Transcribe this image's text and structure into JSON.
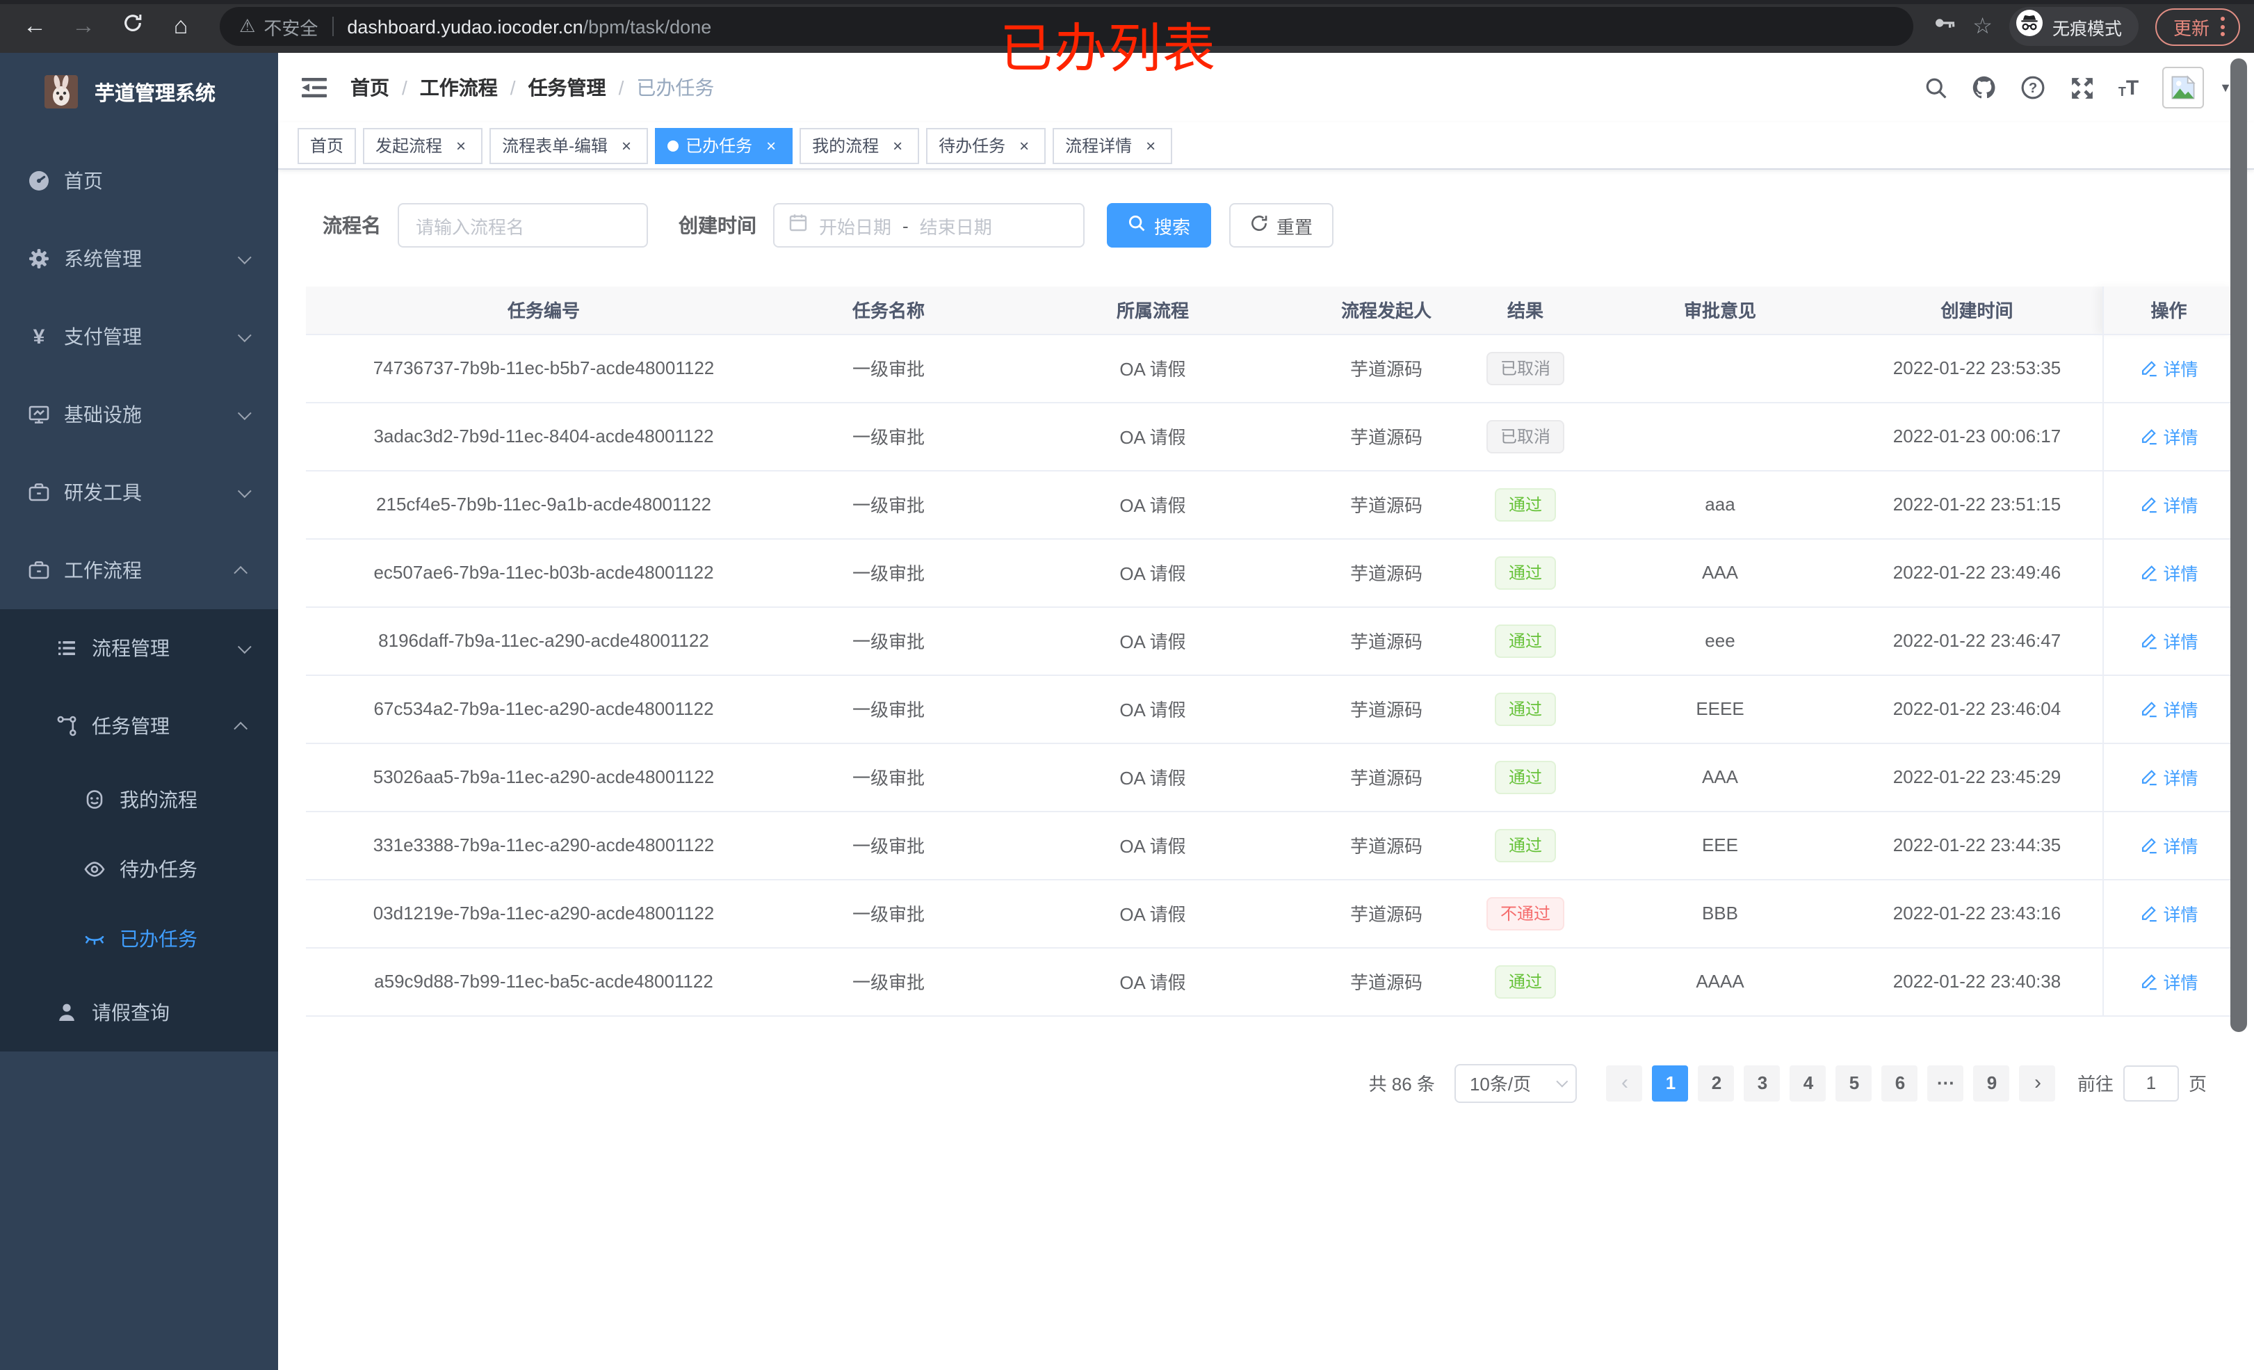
{
  "browser": {
    "security_label": "不安全",
    "url_host": "dashboard.yudao.iocoder.cn",
    "url_path": "/bpm/task/done",
    "incognito_label": "无痕模式",
    "update_label": "更新"
  },
  "icons": {
    "back": "←",
    "forward": "→",
    "home": "⌂",
    "star": "☆",
    "warning": "⚠",
    "caret": "▼",
    "close": "×",
    "prev": "‹",
    "next": "›",
    "yen": "¥",
    "question": "?",
    "tsize_small": "T",
    "tsize_big": "T"
  },
  "overlay_title": "已办列表",
  "sidebar": {
    "logo_title": "芋道管理系统",
    "items": [
      {
        "label": "首页"
      },
      {
        "label": "系统管理"
      },
      {
        "label": "支付管理"
      },
      {
        "label": "基础设施"
      },
      {
        "label": "研发工具"
      },
      {
        "label": "工作流程"
      }
    ],
    "submenu": [
      {
        "label": "流程管理"
      },
      {
        "label": "任务管理"
      },
      {
        "label": "我的流程"
      },
      {
        "label": "待办任务"
      },
      {
        "label": "已办任务"
      },
      {
        "label": "请假查询"
      }
    ]
  },
  "header": {
    "breadcrumb": [
      "首页",
      "工作流程",
      "任务管理",
      "已办任务"
    ],
    "separator": "/"
  },
  "tabs": [
    {
      "label": "首页"
    },
    {
      "label": "发起流程"
    },
    {
      "label": "流程表单-编辑"
    },
    {
      "label": "已办任务"
    },
    {
      "label": "我的流程"
    },
    {
      "label": "待办任务"
    },
    {
      "label": "流程详情"
    }
  ],
  "filters": {
    "name_label": "流程名",
    "name_placeholder": "请输入流程名",
    "time_label": "创建时间",
    "start_placeholder": "开始日期",
    "range_separator": "-",
    "end_placeholder": "结束日期",
    "search_label": "搜索",
    "reset_label": "重置"
  },
  "table": {
    "columns": [
      "任务编号",
      "任务名称",
      "所属流程",
      "流程发起人",
      "结果",
      "审批意见",
      "创建时间",
      "操作"
    ],
    "detail_label": "详情",
    "rows": [
      {
        "id": "74736737-7b9b-11ec-b5b7-acde48001122",
        "name": "一级审批",
        "process": "OA 请假",
        "initiator": "芋道源码",
        "result": "已取消",
        "comment": "",
        "time": "2022-01-22 23:53:35"
      },
      {
        "id": "3adac3d2-7b9d-11ec-8404-acde48001122",
        "name": "一级审批",
        "process": "OA 请假",
        "initiator": "芋道源码",
        "result": "已取消",
        "comment": "",
        "time": "2022-01-23 00:06:17"
      },
      {
        "id": "215cf4e5-7b9b-11ec-9a1b-acde48001122",
        "name": "一级审批",
        "process": "OA 请假",
        "initiator": "芋道源码",
        "result": "通过",
        "comment": "aaa",
        "time": "2022-01-22 23:51:15"
      },
      {
        "id": "ec507ae6-7b9a-11ec-b03b-acde48001122",
        "name": "一级审批",
        "process": "OA 请假",
        "initiator": "芋道源码",
        "result": "通过",
        "comment": "AAA",
        "time": "2022-01-22 23:49:46"
      },
      {
        "id": "8196daff-7b9a-11ec-a290-acde48001122",
        "name": "一级审批",
        "process": "OA 请假",
        "initiator": "芋道源码",
        "result": "通过",
        "comment": "eee",
        "time": "2022-01-22 23:46:47"
      },
      {
        "id": "67c534a2-7b9a-11ec-a290-acde48001122",
        "name": "一级审批",
        "process": "OA 请假",
        "initiator": "芋道源码",
        "result": "通过",
        "comment": "EEEE",
        "time": "2022-01-22 23:46:04"
      },
      {
        "id": "53026aa5-7b9a-11ec-a290-acde48001122",
        "name": "一级审批",
        "process": "OA 请假",
        "initiator": "芋道源码",
        "result": "通过",
        "comment": "AAA",
        "time": "2022-01-22 23:45:29"
      },
      {
        "id": "331e3388-7b9a-11ec-a290-acde48001122",
        "name": "一级审批",
        "process": "OA 请假",
        "initiator": "芋道源码",
        "result": "通过",
        "comment": "EEE",
        "time": "2022-01-22 23:44:35"
      },
      {
        "id": "03d1219e-7b9a-11ec-a290-acde48001122",
        "name": "一级审批",
        "process": "OA 请假",
        "initiator": "芋道源码",
        "result": "不通过",
        "comment": "BBB",
        "time": "2022-01-22 23:43:16"
      },
      {
        "id": "a59c9d88-7b99-11ec-ba5c-acde48001122",
        "name": "一级审批",
        "process": "OA 请假",
        "initiator": "芋道源码",
        "result": "通过",
        "comment": "AAAA",
        "time": "2022-01-22 23:40:38"
      }
    ]
  },
  "pagination": {
    "total_label": "共 86 条",
    "page_size_label": "10条/页",
    "pages": [
      "1",
      "2",
      "3",
      "4",
      "5",
      "6",
      "···",
      "9"
    ],
    "goto_label": "前往",
    "goto_value": "1",
    "goto_unit": "页"
  },
  "colors": {
    "accent": "#409EFF",
    "success": "#67C23A",
    "danger": "#F56C6C",
    "info": "#909399",
    "sidebar": "#304156",
    "submenu": "#1F2D3D"
  }
}
